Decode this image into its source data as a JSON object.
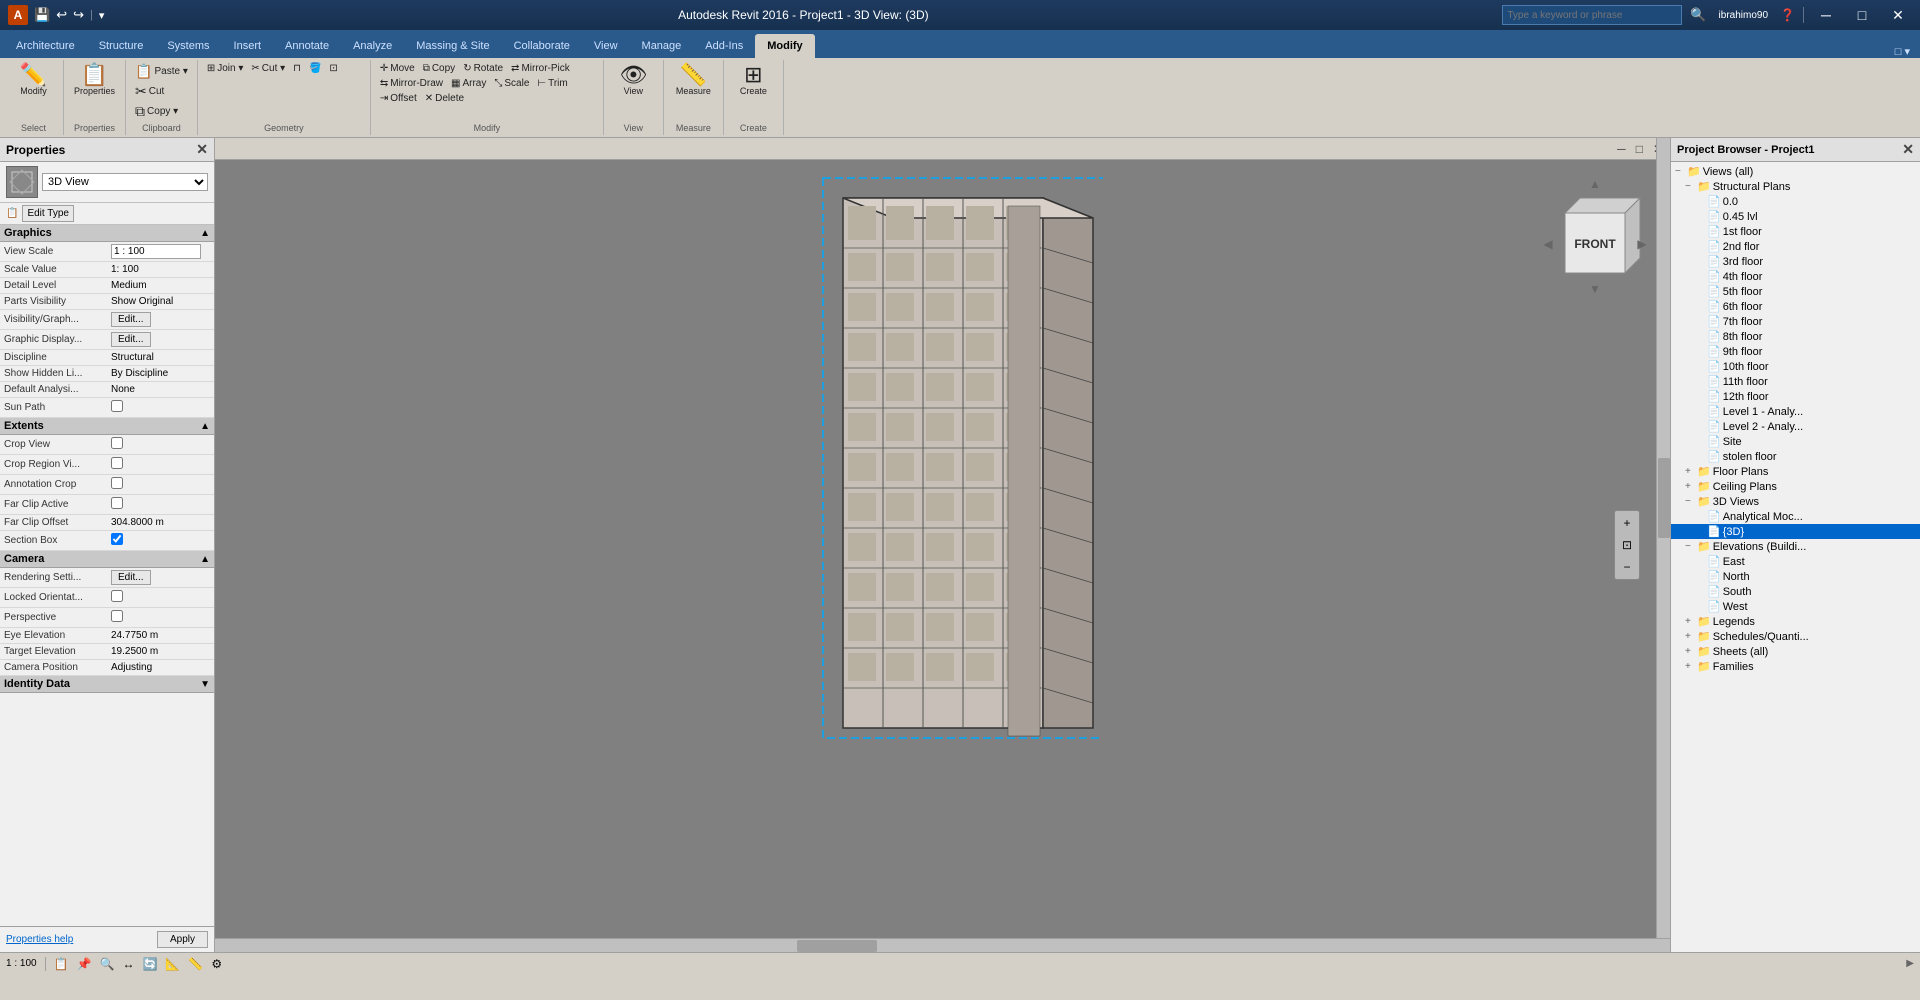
{
  "titlebar": {
    "title": "Autodesk Revit 2016 - Project1 - 3D View: (3D)",
    "user": "ibrahimo90",
    "search_placeholder": "Type a keyword or phrase",
    "app_icon": "A",
    "minimize_label": "─",
    "maximize_label": "□",
    "close_label": "✕"
  },
  "qat": {
    "buttons": [
      "💾",
      "↩",
      "↪"
    ]
  },
  "ribbon": {
    "active_tab": "Modify",
    "tabs": [
      "Architecture",
      "Structure",
      "Systems",
      "Insert",
      "Annotate",
      "Analyze",
      "Massing & Site",
      "Collaborate",
      "View",
      "Manage",
      "Add-Ins",
      "Modify"
    ],
    "groups": {
      "select": {
        "label": "Select",
        "items": [
          "Modify"
        ]
      },
      "properties": {
        "label": "Properties",
        "items": [
          "Properties"
        ]
      },
      "clipboard": {
        "label": "Clipboard",
        "items": [
          "Paste",
          "Cut",
          "Copy"
        ]
      },
      "geometry": {
        "label": "Geometry",
        "items": [
          "Join",
          "Split"
        ]
      },
      "modify": {
        "label": "Modify",
        "items": [
          "Move",
          "Copy",
          "Rotate",
          "Mirror",
          "Array",
          "Scale",
          "Trim",
          "Offset",
          "Delete"
        ]
      },
      "view": {
        "label": "View",
        "items": [
          "View"
        ]
      },
      "measure": {
        "label": "Measure",
        "items": [
          "Measure"
        ]
      },
      "create": {
        "label": "Create",
        "items": [
          "Create"
        ]
      }
    }
  },
  "properties": {
    "header": "Properties",
    "type_selector": "3D View",
    "edit_type_label": "Edit Type",
    "sections": {
      "graphics": {
        "label": "Graphics",
        "expanded": true,
        "rows": [
          {
            "label": "View Scale",
            "value": "1 : 100",
            "type": "input"
          },
          {
            "label": "Scale Value",
            "value": "1:  100",
            "type": "text"
          },
          {
            "label": "Detail Level",
            "value": "Medium",
            "type": "text"
          },
          {
            "label": "Parts Visibility",
            "value": "Show Original",
            "type": "text"
          },
          {
            "label": "Visibility/Graph...",
            "value": "Edit...",
            "type": "button"
          },
          {
            "label": "Graphic Display...",
            "value": "Edit...",
            "type": "button"
          },
          {
            "label": "Discipline",
            "value": "Structural",
            "type": "text"
          },
          {
            "label": "Show Hidden Li...",
            "value": "By Discipline",
            "type": "text"
          },
          {
            "label": "Default Analysi...",
            "value": "None",
            "type": "text"
          },
          {
            "label": "Sun Path",
            "value": "",
            "type": "checkbox",
            "checked": false
          }
        ]
      },
      "extents": {
        "label": "Extents",
        "expanded": true,
        "rows": [
          {
            "label": "Crop View",
            "value": "",
            "type": "checkbox",
            "checked": false
          },
          {
            "label": "Crop Region Vi...",
            "value": "",
            "type": "checkbox",
            "checked": false
          },
          {
            "label": "Annotation Crop",
            "value": "",
            "type": "checkbox",
            "checked": false
          },
          {
            "label": "Far Clip Active",
            "value": "",
            "type": "checkbox",
            "checked": false
          },
          {
            "label": "Far Clip Offset",
            "value": "304.8000 m",
            "type": "text"
          },
          {
            "label": "Section Box",
            "value": "",
            "type": "checkbox",
            "checked": true
          }
        ]
      },
      "camera": {
        "label": "Camera",
        "expanded": true,
        "rows": [
          {
            "label": "Rendering Setti...",
            "value": "Edit...",
            "type": "button"
          },
          {
            "label": "Locked Orientat...",
            "value": "",
            "type": "checkbox",
            "checked": false
          },
          {
            "label": "Perspective",
            "value": "",
            "type": "checkbox",
            "checked": false
          },
          {
            "label": "Eye Elevation",
            "value": "24.7750 m",
            "type": "text"
          },
          {
            "label": "Target Elevation",
            "value": "19.2500 m",
            "type": "text"
          },
          {
            "label": "Camera Position",
            "value": "Adjusting",
            "type": "text"
          }
        ]
      },
      "identity": {
        "label": "Identity Data",
        "expanded": false,
        "rows": []
      }
    },
    "footer": {
      "help_link": "Properties help",
      "apply_btn": "Apply"
    }
  },
  "viewport": {
    "title": "3D View: (3D)",
    "nav_cube_label": "FRONT",
    "scale_label": "1 : 100"
  },
  "project_browser": {
    "header": "Project Browser - Project1",
    "tree": [
      {
        "level": 0,
        "label": "Views (all)",
        "toggle": "−",
        "type": "folder"
      },
      {
        "level": 1,
        "label": "Structural Plans",
        "toggle": "−",
        "type": "folder"
      },
      {
        "level": 2,
        "label": "0.0",
        "type": "item"
      },
      {
        "level": 2,
        "label": "0.45 lvl",
        "type": "item"
      },
      {
        "level": 2,
        "label": "1st floor",
        "type": "item"
      },
      {
        "level": 2,
        "label": "2nd flor",
        "type": "item"
      },
      {
        "level": 2,
        "label": "3rd floor",
        "type": "item"
      },
      {
        "level": 2,
        "label": "4th floor",
        "type": "item"
      },
      {
        "level": 2,
        "label": "5th floor",
        "type": "item"
      },
      {
        "level": 2,
        "label": "6th floor",
        "type": "item"
      },
      {
        "level": 2,
        "label": "7th floor",
        "type": "item"
      },
      {
        "level": 2,
        "label": "8th floor",
        "type": "item"
      },
      {
        "level": 2,
        "label": "9th floor",
        "type": "item"
      },
      {
        "level": 2,
        "label": "10th floor",
        "type": "item"
      },
      {
        "level": 2,
        "label": "11th floor",
        "type": "item"
      },
      {
        "level": 2,
        "label": "12th floor",
        "type": "item"
      },
      {
        "level": 2,
        "label": "Level 1 - Analy...",
        "type": "item"
      },
      {
        "level": 2,
        "label": "Level 2 - Analy...",
        "type": "item"
      },
      {
        "level": 2,
        "label": "Site",
        "type": "item"
      },
      {
        "level": 2,
        "label": "stolen floor",
        "type": "item"
      },
      {
        "level": 1,
        "label": "Floor Plans",
        "toggle": "+",
        "type": "folder"
      },
      {
        "level": 1,
        "label": "Ceiling Plans",
        "toggle": "+",
        "type": "folder"
      },
      {
        "level": 1,
        "label": "3D Views",
        "toggle": "−",
        "type": "folder"
      },
      {
        "level": 2,
        "label": "Analytical Moc...",
        "type": "item"
      },
      {
        "level": 2,
        "label": "{3D}",
        "type": "item",
        "active": true
      },
      {
        "level": 1,
        "label": "Elevations (Buildi...",
        "toggle": "−",
        "type": "folder"
      },
      {
        "level": 2,
        "label": "East",
        "type": "item"
      },
      {
        "level": 2,
        "label": "North",
        "type": "item"
      },
      {
        "level": 2,
        "label": "South",
        "type": "item"
      },
      {
        "level": 2,
        "label": "West",
        "type": "item"
      },
      {
        "level": 1,
        "label": "Legends",
        "toggle": "+",
        "type": "folder"
      },
      {
        "level": 1,
        "label": "Schedules/Quanti...",
        "toggle": "+",
        "type": "folder"
      },
      {
        "level": 1,
        "label": "Sheets (all)",
        "toggle": "+",
        "type": "folder"
      },
      {
        "level": 1,
        "label": "Families",
        "toggle": "+",
        "type": "folder"
      }
    ]
  },
  "statusbar": {
    "scale": "1 : 100",
    "tools": [
      "📋",
      "📌",
      "🔍",
      "↔",
      "🔄",
      "📐",
      "📏",
      "⚙"
    ]
  }
}
